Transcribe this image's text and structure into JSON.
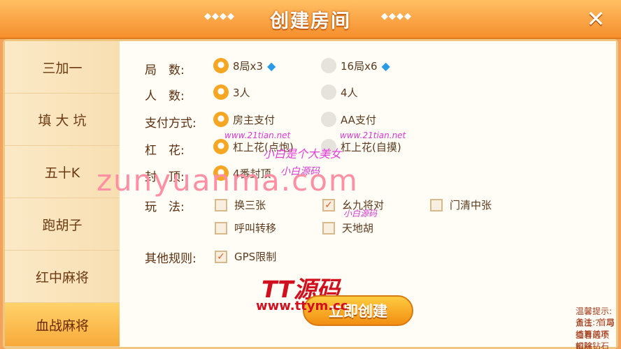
{
  "header": {
    "title": "创建房间",
    "deco_left": "◆◆◆◆",
    "deco_right": "◆◆◆◆",
    "close": "✕"
  },
  "sidebar": {
    "items": [
      {
        "label": "三加一"
      },
      {
        "label": "填 大 坑"
      },
      {
        "label": "五十K"
      },
      {
        "label": "跑胡子"
      },
      {
        "label": "红中麻将"
      },
      {
        "label": "血战麻将"
      }
    ],
    "active_index": 5
  },
  "options": {
    "rounds": {
      "label": "局　数:",
      "choices": [
        "8局x3",
        "16局x6"
      ],
      "selected": 0
    },
    "players": {
      "label": "人　数:",
      "choices": [
        "3人",
        "4人"
      ],
      "selected": 0
    },
    "payment": {
      "label": "支付方式:",
      "choices": [
        "房主支付",
        "AA支付"
      ],
      "selected": 0
    },
    "gang": {
      "label": "杠　花:",
      "choices": [
        "杠上花(点炮)",
        "杠上花(自摸)"
      ],
      "selected": 0
    },
    "cap": {
      "label": "封　顶:",
      "choices": [
        "4番封顶"
      ],
      "selected": 0
    },
    "play": {
      "label": "玩　法:",
      "choices": [
        "换三张",
        "幺九将对",
        "门清中张",
        "呼叫转移",
        "天地胡"
      ],
      "checked": [
        false,
        true,
        false,
        false,
        false
      ]
    },
    "other": {
      "label": "其他规则:",
      "choices": [
        "GPS限制"
      ],
      "checked": [
        true
      ]
    }
  },
  "create_button": "立即创建",
  "hint": {
    "line1": "温馨提示: 点击 ？ 可查看选项解释",
    "line2": "备注: 首局结算前不扣除钻石"
  },
  "watermarks": {
    "big": "zunyuanma.com",
    "tt": "TT源码",
    "tt_site": "www.ttym.cc",
    "girl": "小白是个大美女",
    "site1": "www.21tian.net",
    "small1": "小白源码",
    "small2": "www.21tian.net",
    "small3": "小白源码"
  },
  "colors": {
    "accent": "#f5a623",
    "header": "#f58f2c",
    "text": "#5b2f0f"
  }
}
